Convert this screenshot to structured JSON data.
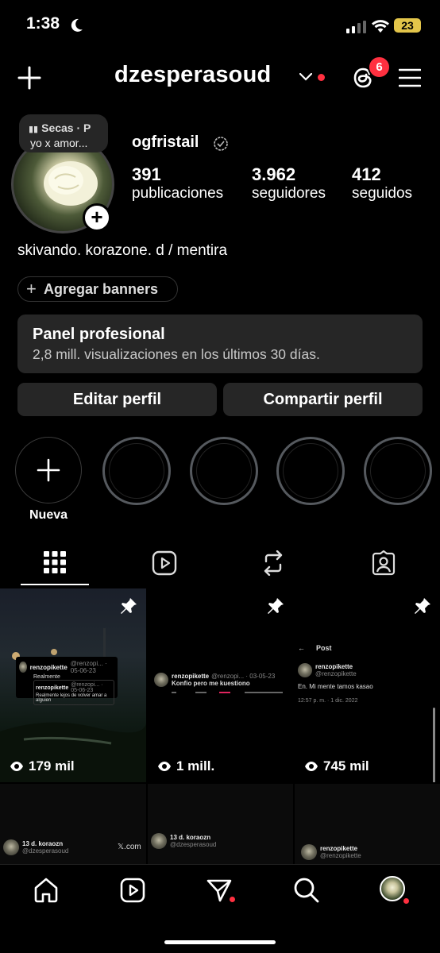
{
  "status": {
    "time": "1:38",
    "battery": "23"
  },
  "header": {
    "username": "dzesperasoud",
    "threads_badge": "6"
  },
  "note": {
    "line1": "Secas · P",
    "line2": "yo x amor..."
  },
  "profile": {
    "display_name": "ogfristail",
    "stats": [
      {
        "value": "391",
        "label": "publicaciones"
      },
      {
        "value": "3.962",
        "label": "seguidores"
      },
      {
        "value": "412",
        "label": "seguidos"
      }
    ],
    "bio": "skivando. korazone. d / mentira",
    "banners_label": "Agregar banners"
  },
  "pro_panel": {
    "title": "Panel profesional",
    "subtitle": "2,8 mill. visualizaciones en los últimos 30 días."
  },
  "actions": {
    "edit": "Editar perfil",
    "share": "Compartir perfil"
  },
  "highlights": {
    "new_label": "Nueva",
    "plus": "+"
  },
  "posts": [
    {
      "views": "179 mil",
      "tweet_name": "renzopikette",
      "tweet_handle": "@renzopi... · 05-06-23",
      "tweet_text": "Realmente",
      "quote_name": "renzopikette",
      "quote_handle": "@renzopi... · 05-06-23",
      "quote_text": "Realmente lejos de volver amar a alguien"
    },
    {
      "views": "1 mill.",
      "tweet_name": "renzopikette",
      "tweet_handle": "@renzopi... · 03-05-23",
      "tweet_text": "Konfio pero me kuestiono"
    },
    {
      "views": "745 mil",
      "post_header": "Post",
      "tweet_name": "renzopikette",
      "tweet_handle": "@renzopikette",
      "tweet_text": "En. Mi mente tamos kasao",
      "tweet_time": "12:57 p. m. · 1 dic. 2022"
    },
    {
      "name": "13 d. koraozn",
      "handle": "@dzesperasoud",
      "brand": "𝕏.com"
    },
    {
      "name": "13 d. koraozn",
      "handle": "@dzesperasoud"
    },
    {
      "name": "renzopikette",
      "handle": "@renzopikette"
    }
  ]
}
